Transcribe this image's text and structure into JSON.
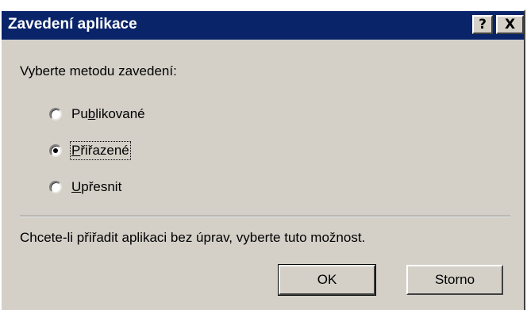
{
  "window": {
    "title": "Zavedení aplikace",
    "help_label": "?",
    "close_label": "X"
  },
  "prompt": "Vyberte metodu zavedení:",
  "options": [
    {
      "label": "Publikované",
      "mnemonic": "b",
      "checked": false
    },
    {
      "label": "Přiřazené",
      "mnemonic": "P",
      "checked": true
    },
    {
      "label": "Upřesnit",
      "mnemonic": "U",
      "checked": false
    }
  ],
  "info": "Chcete-li přiřadit aplikaci bez úprav, vyberte tuto možnost.",
  "buttons": {
    "ok_label": "OK",
    "cancel_label": "Storno"
  }
}
